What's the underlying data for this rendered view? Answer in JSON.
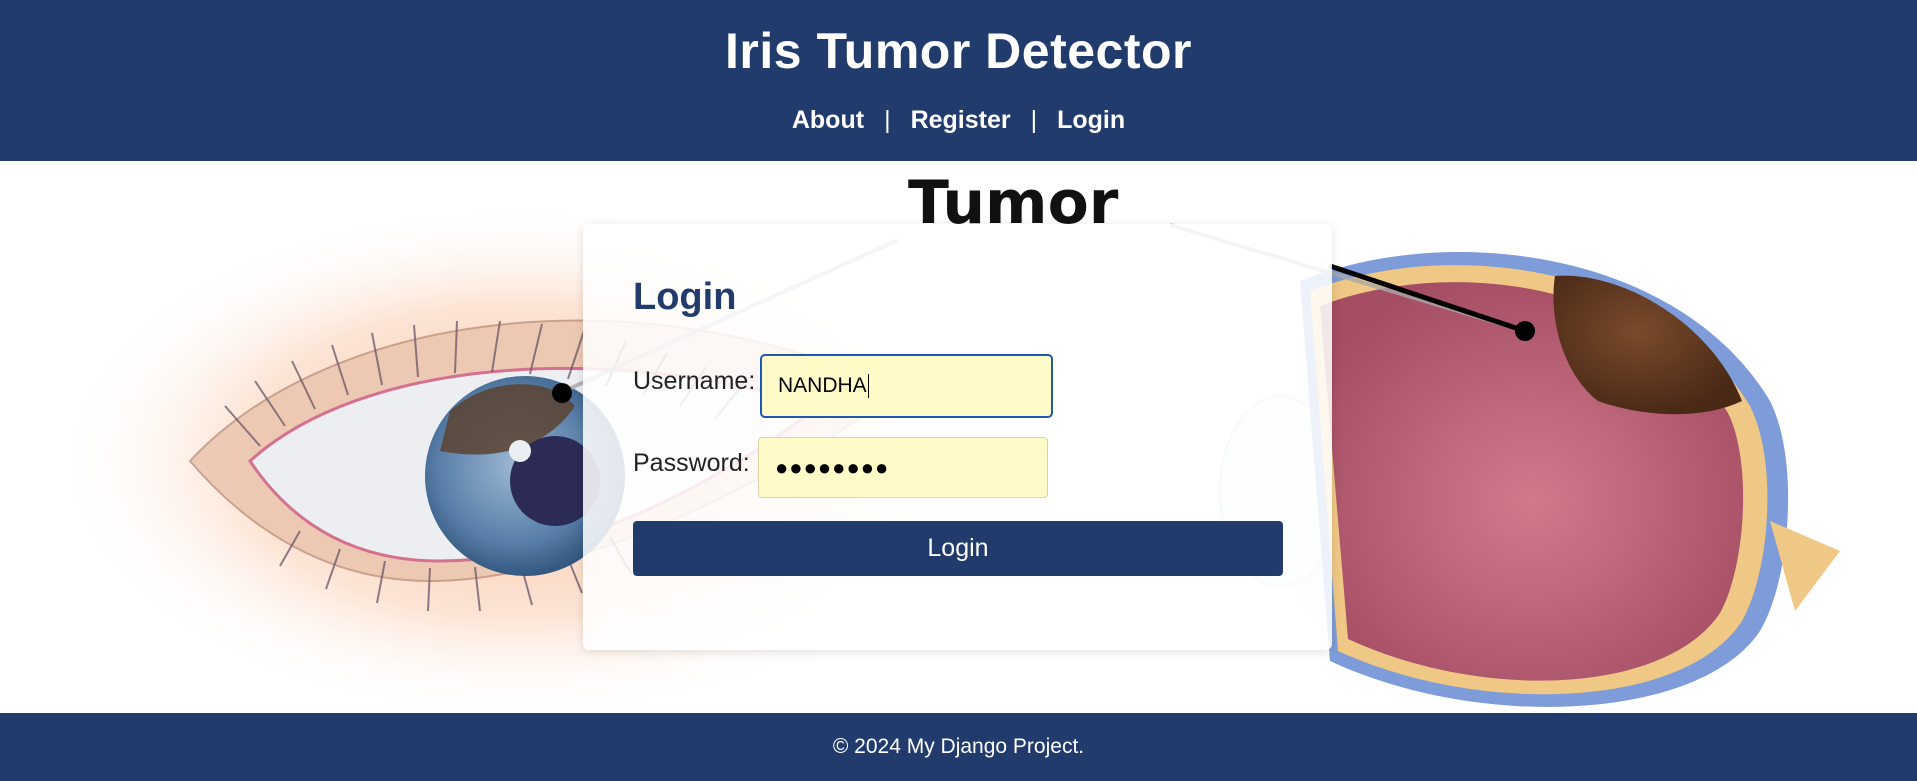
{
  "header": {
    "title": "Iris Tumor Detector",
    "nav": [
      {
        "label": "About"
      },
      {
        "label": "Register"
      },
      {
        "label": "Login"
      }
    ],
    "separator": "|"
  },
  "background": {
    "label": "Tumor"
  },
  "login_form": {
    "heading": "Login",
    "username_label": "Username:",
    "username_value": "NANDHA",
    "password_label": "Password:",
    "password_value": "●●●●●●●●",
    "submit_label": "Login"
  },
  "footer": {
    "text": "© 2024 My Django Project."
  },
  "colors": {
    "primary": "#213b6d",
    "input_bg": "#fefbc9",
    "focus_border": "#1f57b5"
  }
}
